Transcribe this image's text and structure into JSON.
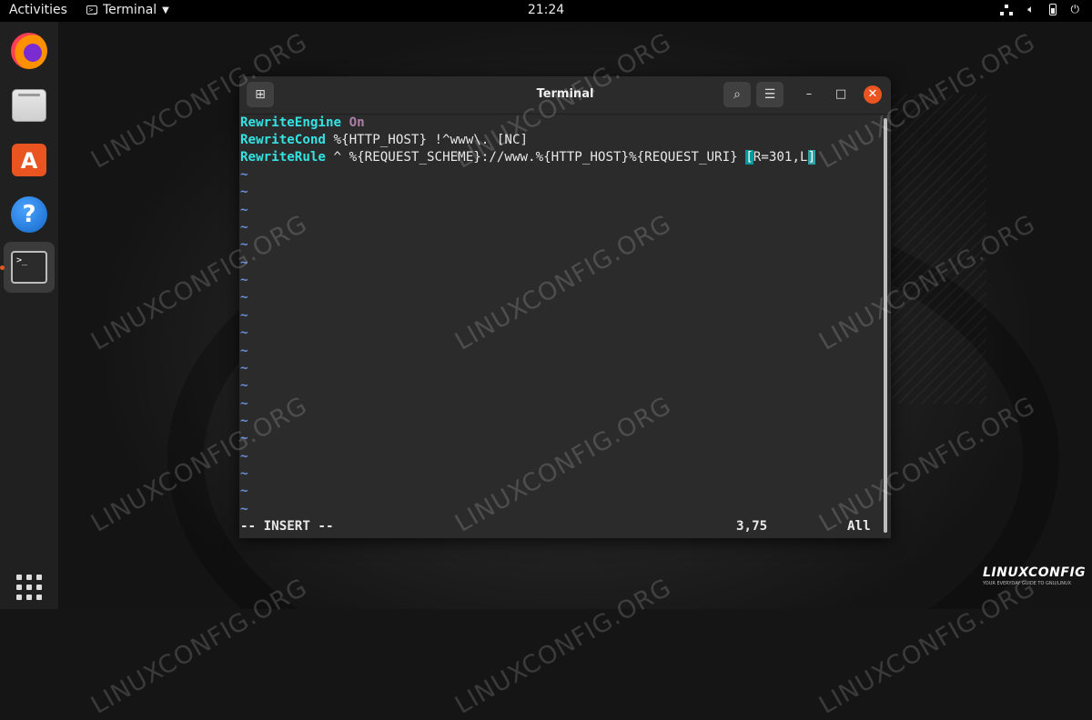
{
  "topbar": {
    "activities": "Activities",
    "app_name": "Terminal",
    "clock": "21:24",
    "icons": [
      "network-icon",
      "volume-icon",
      "battery-icon",
      "power-icon"
    ]
  },
  "dock": {
    "items": [
      "firefox-icon",
      "files-icon",
      "app-store-icon",
      "help-icon",
      "terminal-icon"
    ],
    "active": "terminal-icon",
    "apps_grid": "show-applications-icon"
  },
  "window": {
    "title": "Terminal",
    "new_tab_icon": "new-tab-icon",
    "search_icon": "search-icon",
    "menu_icon": "hamburger-menu-icon",
    "minimize": "minimize-icon",
    "maximize": "maximize-icon",
    "close": "close-icon"
  },
  "editor": {
    "line1": {
      "kw": "RewriteEngine",
      "rest": "On"
    },
    "line2": {
      "kw": "RewriteCond",
      "rest": " %{HTTP_HOST} !^www\\. [NC]"
    },
    "line3": {
      "kw": "RewriteRule",
      "rest": " ^ %{REQUEST_SCHEME}://www.%{HTTP_HOST}%{REQUEST_URI} ",
      "bracket": "[",
      "args": "R=301,L",
      "cursor": "]"
    },
    "tilde": "~",
    "mode": "-- INSERT --",
    "position": "3,75",
    "scroll": "All"
  },
  "watermark": {
    "text": "LINUXCONFIG.ORG",
    "logo": "LINUXCONFIG",
    "logo_tag": "YOUR EVERYDAY GUIDE TO GNU/LINUX"
  },
  "colors": {
    "accent": "#e95420",
    "keyword": "#34e2e2",
    "tilde": "#6a8fd8",
    "value_on": "#ad7fa8"
  }
}
